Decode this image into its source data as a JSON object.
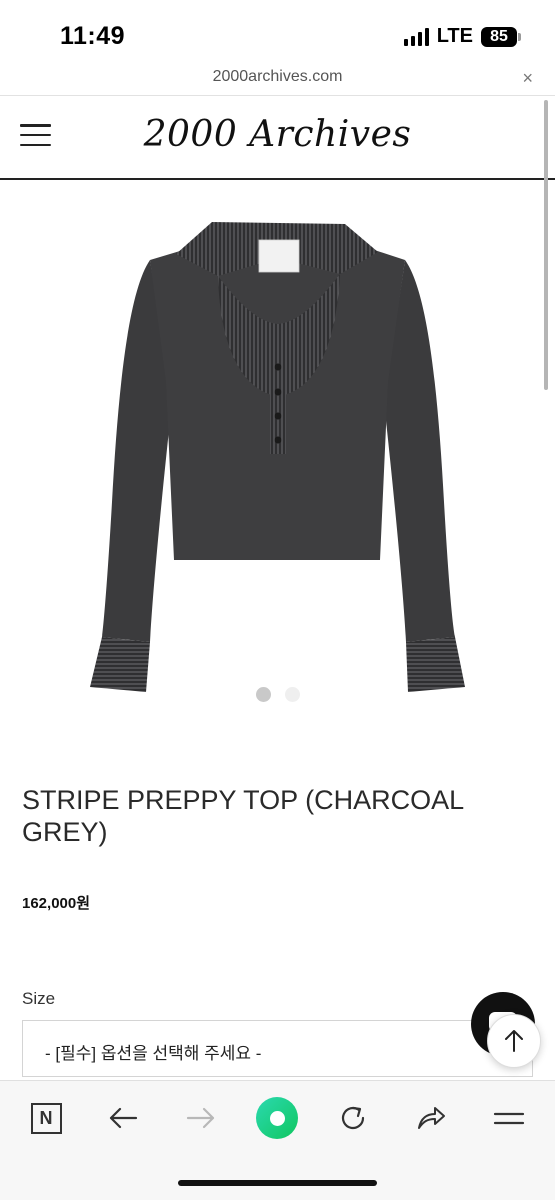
{
  "status_bar": {
    "time": "11:49",
    "network": "LTE",
    "battery": "85"
  },
  "browser": {
    "url": "2000archives.com",
    "close_glyph": "×"
  },
  "site": {
    "logo": "2000 Archives",
    "menu_icon": "hamburger-icon"
  },
  "product": {
    "title": "STRIPE PREPPY TOP (CHARCOAL GREY)",
    "price": "162,000원",
    "image_label": "2000 Archives",
    "image_count": 2,
    "active_image": 1
  },
  "options": {
    "size_label": "Size",
    "size_placeholder": "- [필수] 옵션을 선택해 주세요 -"
  },
  "toolbar": {
    "n_label": "N"
  },
  "colors": {
    "accent": "#10c760",
    "garment": "#3a3a3c",
    "text": "#222222"
  }
}
